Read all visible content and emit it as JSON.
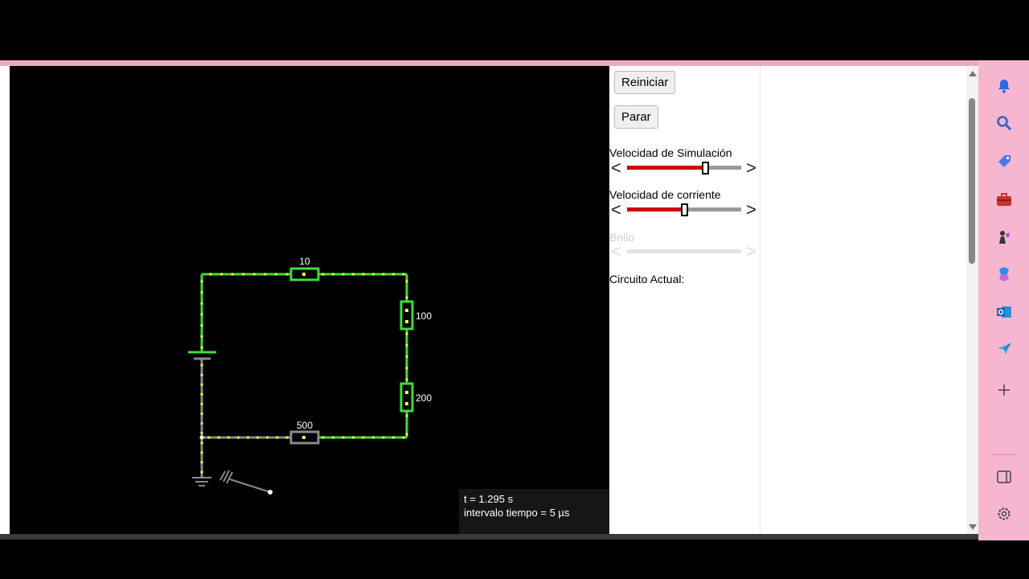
{
  "controls": {
    "reset_label": "Reiniciar",
    "stop_label": "Parar",
    "sim_speed": {
      "label": "Velocidad de Simulación",
      "value": 0.68
    },
    "current_speed": {
      "label": "Velocidad de corriente",
      "value": 0.5
    },
    "brightness": {
      "label": "Brillo",
      "disabled": true
    },
    "circuit_label": "Circuito Actual:",
    "arrow_left": "<",
    "arrow_right": ">"
  },
  "circuit": {
    "resistors": [
      {
        "id": "r-top",
        "label": "10"
      },
      {
        "id": "r-right-upper",
        "label": "100"
      },
      {
        "id": "r-right-lower",
        "label": "200"
      },
      {
        "id": "r-bottom",
        "label": "500"
      }
    ],
    "colors": {
      "active": "#3ddc3d",
      "inactive": "#8a8a8a",
      "dot": "#ffff44"
    }
  },
  "status": {
    "time": "t = 1.295 s",
    "step": "intervalo tiempo = 5 µs"
  },
  "sidebar_icons": [
    "bell-icon",
    "search-icon",
    "tag-icon",
    "toolbox-icon",
    "chess-icon",
    "copilot-icon",
    "outlook-icon",
    "send-icon",
    "plus-icon",
    "sidebar-toggle-icon",
    "settings-icon"
  ],
  "colors": {
    "accent_red": "#cc0000",
    "sidebar_pink": "#f7b6d0"
  }
}
